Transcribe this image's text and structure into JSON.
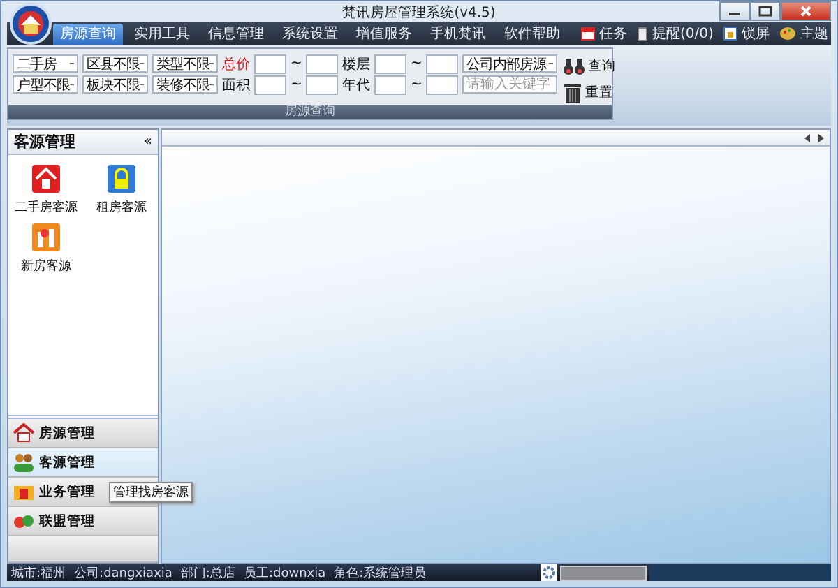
{
  "window": {
    "title": "梵讯房屋管理系统(v4.5)"
  },
  "menu": {
    "tabs": [
      {
        "label": "房源查询",
        "selected": true
      },
      {
        "label": "实用工具",
        "selected": false
      },
      {
        "label": "信息管理",
        "selected": false
      },
      {
        "label": "系统设置",
        "selected": false
      },
      {
        "label": "增值服务",
        "selected": false
      },
      {
        "label": "手机梵讯",
        "selected": false
      },
      {
        "label": "软件帮助",
        "selected": false
      }
    ],
    "actions": [
      {
        "label": "任务",
        "kind": "task"
      },
      {
        "label": "提醒(0/0)",
        "kind": "remind"
      },
      {
        "label": "锁屏",
        "kind": "lock"
      },
      {
        "label": "主题",
        "kind": "theme"
      }
    ]
  },
  "search": {
    "caption": "房源查询",
    "rows": [
      {
        "selects": [
          "二手房",
          "区县不限",
          "类型不限"
        ],
        "ranges": [
          {
            "label": "总价",
            "highlight": true,
            "separator": "~"
          },
          {
            "label": "楼层",
            "highlight": false,
            "separator": "~"
          }
        ],
        "tail": {
          "kind": "select",
          "text": "公司内部房源"
        }
      },
      {
        "selects": [
          "户型不限",
          "板块不限",
          "装修不限"
        ],
        "ranges": [
          {
            "label": "面积",
            "highlight": false,
            "separator": "~"
          },
          {
            "label": "年代",
            "highlight": false,
            "separator": "~"
          }
        ],
        "tail": {
          "kind": "keyword",
          "placeholder": "请输入关键字"
        }
      }
    ],
    "buttons": [
      {
        "label": "查询",
        "kind": "search"
      },
      {
        "label": "重置",
        "kind": "reset"
      }
    ]
  },
  "left_panel": {
    "title": "客源管理",
    "collapse": "«",
    "items": [
      {
        "label": "二手房客源",
        "kind": "house"
      },
      {
        "label": "租房客源",
        "kind": "lock"
      },
      {
        "label": "新房客源",
        "kind": "building"
      }
    ]
  },
  "nav": [
    {
      "label": "房源管理",
      "kind": "house",
      "selected": false
    },
    {
      "label": "客源管理",
      "kind": "people",
      "selected": true
    },
    {
      "label": "业务管理",
      "kind": "folder",
      "selected": false
    },
    {
      "label": "联盟管理",
      "kind": "link",
      "selected": false
    }
  ],
  "tooltip": "管理找房客源",
  "status_bar": [
    "城市:福州",
    "公司:dangxiaxia",
    "部门:总店",
    "员工:downxia",
    "角色:系统管理员"
  ]
}
